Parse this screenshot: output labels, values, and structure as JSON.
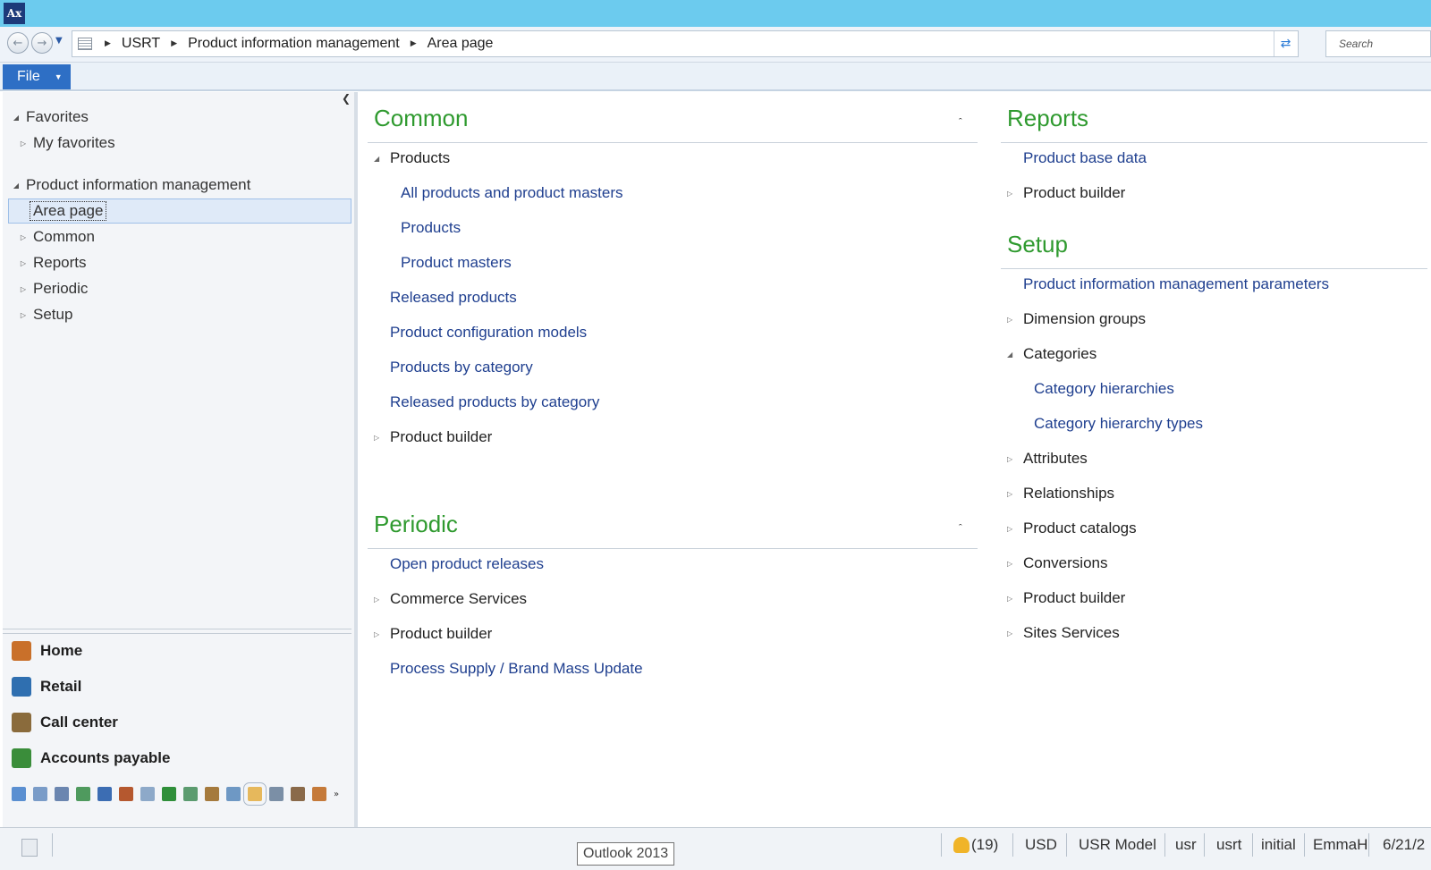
{
  "app": {
    "logo_text": "Ax"
  },
  "address": {
    "crumbs": [
      "USRT",
      "Product information management",
      "Area page"
    ],
    "search_placeholder": "Search"
  },
  "menu": {
    "file_label": "File"
  },
  "navpane": {
    "tree": [
      {
        "label": "Favorites",
        "state": "expanded"
      },
      {
        "label": "My favorites",
        "state": "collapsed"
      },
      {
        "label": "Product information management",
        "state": "expanded"
      },
      {
        "label": "Area page",
        "state": "selected"
      },
      {
        "label": "Common",
        "state": "collapsed"
      },
      {
        "label": "Reports",
        "state": "collapsed"
      },
      {
        "label": "Periodic",
        "state": "collapsed"
      },
      {
        "label": "Setup",
        "state": "collapsed"
      }
    ],
    "modules": [
      {
        "label": "Home",
        "icon": "house-icon",
        "color": "#c9702a"
      },
      {
        "label": "Retail",
        "icon": "retail-icon",
        "color": "#2f6fb0"
      },
      {
        "label": "Call center",
        "icon": "call-center-icon",
        "color": "#8a6b3c"
      },
      {
        "label": "Accounts payable",
        "icon": "accounts-payable-icon",
        "color": "#3a8d3a"
      }
    ]
  },
  "content": {
    "common": {
      "title": "Common",
      "items": [
        {
          "label": "Products",
          "kind": "group",
          "arrow": "expanded"
        },
        {
          "label": "All products and product masters",
          "kind": "link"
        },
        {
          "label": "Products",
          "kind": "link"
        },
        {
          "label": "Product masters",
          "kind": "link"
        },
        {
          "label": "Released products",
          "kind": "link"
        },
        {
          "label": "Product configuration models",
          "kind": "link"
        },
        {
          "label": "Products by category",
          "kind": "link"
        },
        {
          "label": "Released products by category",
          "kind": "link"
        },
        {
          "label": "Product builder",
          "kind": "group",
          "arrow": "collapsed"
        }
      ]
    },
    "periodic": {
      "title": "Periodic",
      "items": [
        {
          "label": "Open product releases",
          "kind": "link"
        },
        {
          "label": "Commerce Services",
          "kind": "group",
          "arrow": "collapsed"
        },
        {
          "label": "Product builder",
          "kind": "group",
          "arrow": "collapsed"
        },
        {
          "label": "Process Supply / Brand Mass Update",
          "kind": "link"
        }
      ]
    },
    "reports": {
      "title": "Reports",
      "items": [
        {
          "label": "Product base data",
          "kind": "link"
        },
        {
          "label": "Product builder",
          "kind": "group",
          "arrow": "collapsed"
        }
      ]
    },
    "setup": {
      "title": "Setup",
      "items": [
        {
          "label": "Product information management parameters",
          "kind": "link"
        },
        {
          "label": "Dimension groups",
          "kind": "group",
          "arrow": "collapsed"
        },
        {
          "label": "Categories",
          "kind": "group",
          "arrow": "expanded"
        },
        {
          "label": "Category hierarchies",
          "kind": "link"
        },
        {
          "label": "Category hierarchy types",
          "kind": "link"
        },
        {
          "label": "Attributes",
          "kind": "group",
          "arrow": "collapsed"
        },
        {
          "label": "Relationships",
          "kind": "group",
          "arrow": "collapsed"
        },
        {
          "label": "Product catalogs",
          "kind": "group",
          "arrow": "collapsed"
        },
        {
          "label": "Conversions",
          "kind": "group",
          "arrow": "collapsed"
        },
        {
          "label": "Product builder",
          "kind": "group",
          "arrow": "collapsed"
        },
        {
          "label": "Sites Services",
          "kind": "group",
          "arrow": "collapsed"
        }
      ]
    }
  },
  "statusbar": {
    "tooltip": "Outlook 2013",
    "notifications": "(19)",
    "currency": "USD",
    "model": "USR Model",
    "layer": "usr",
    "company": "usrt",
    "partition": "initial",
    "user": "EmmaH",
    "date": "6/21/2"
  },
  "colors": {
    "titlebar": "#6ccbee",
    "section_title": "#2f9a2f",
    "link": "#1f3f8f",
    "file_button": "#2e6fc5"
  }
}
